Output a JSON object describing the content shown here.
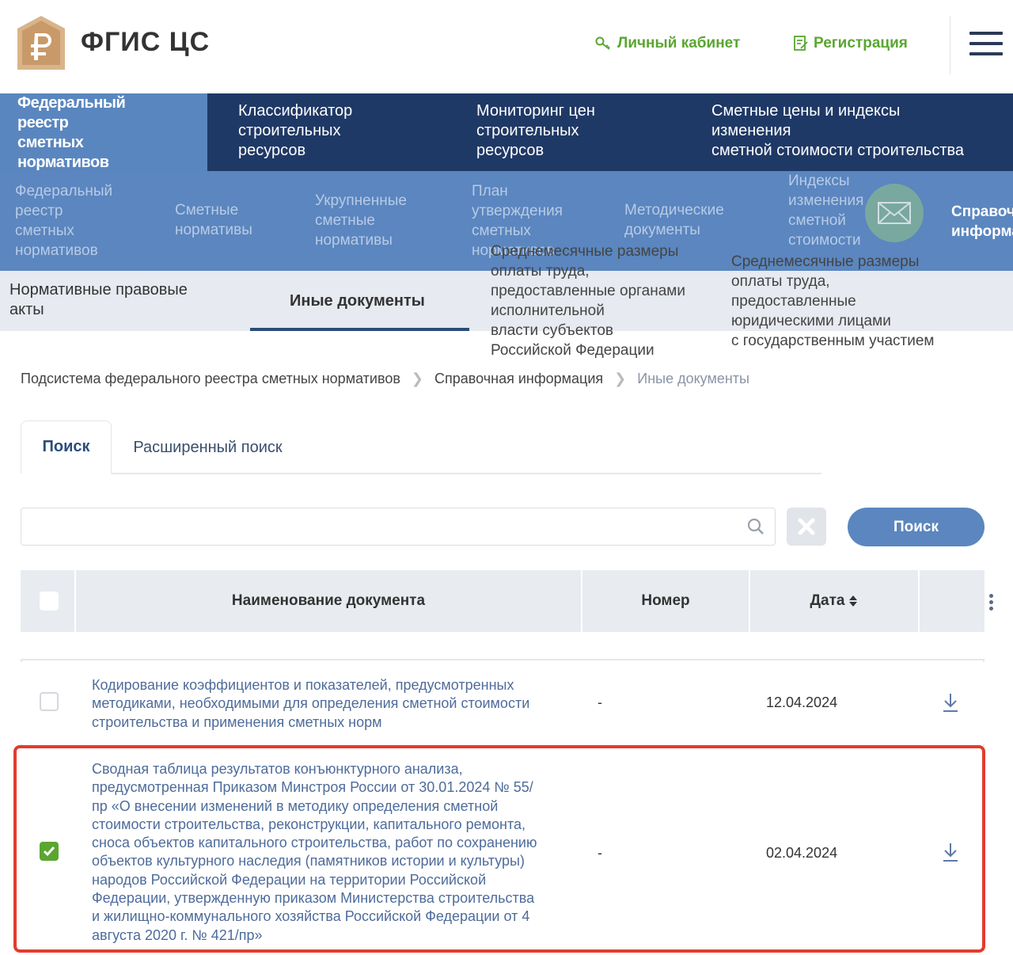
{
  "header": {
    "logo_title": "ФГИС ЦС",
    "cabinet_label": "Личный кабинет",
    "register_label": "Регистрация"
  },
  "topnav": {
    "items": [
      {
        "label_lines": [
          "Федеральный",
          "реестр",
          "сметных",
          "нормативов"
        ]
      },
      {
        "label_lines": [
          "Классификатор",
          "строительных",
          "ресурсов"
        ]
      },
      {
        "label_lines": [
          "Мониторинг цен",
          "строительных",
          "ресурсов"
        ]
      },
      {
        "label_lines": [
          "Сметные цены и индексы",
          "изменения",
          "сметной стоимости строительства"
        ]
      }
    ]
  },
  "subnav": {
    "items": [
      {
        "lines": [
          "Федеральный",
          "реестр",
          "сметных",
          "нормативов"
        ]
      },
      {
        "lines": [
          "Сметные",
          "нормативы"
        ]
      },
      {
        "lines": [
          "Укрупненные",
          "сметные",
          "нормативы"
        ]
      },
      {
        "lines": [
          "План",
          "утверждения",
          "сметных",
          "нормативов"
        ]
      },
      {
        "lines": [
          "Методические",
          "документы"
        ]
      },
      {
        "lines": [
          "Индексы",
          "изменения",
          "сметной",
          "стоимости"
        ]
      },
      {
        "lines": [
          "Справочная",
          "информация"
        ]
      }
    ]
  },
  "tertiary": {
    "items": [
      {
        "lines": [
          "Нормативные правовые",
          "акты"
        ]
      },
      {
        "lines": [
          "Иные документы"
        ]
      }
    ],
    "dropdown_1": [
      "Среднемесячные размеры",
      "оплаты труда,",
      "предоставленные органами",
      "исполнительной",
      "власти субъектов",
      "Российской Федерации"
    ],
    "dropdown_2": [
      "Среднемесячные размеры",
      "оплаты труда,",
      "предоставленные",
      "юридическими лицами",
      "с государственным участием"
    ]
  },
  "breadcrumbs": {
    "items": [
      "Подсистема федерального реестра сметных нормативов",
      "Справочная информация",
      "Иные документы"
    ]
  },
  "search_tabs": {
    "basic": "Поиск",
    "advanced": "Расширенный поиск"
  },
  "search": {
    "value": "",
    "button_label": "Поиск"
  },
  "table": {
    "headers": {
      "name": "Наименование документа",
      "number": "Номер",
      "date": "Дата"
    },
    "rows": [
      {
        "name_lines": [
          "Кодирование коэффициентов и показателей, предусмотренных",
          "методиками, необходимыми для определения сметной стоимости",
          "строительства и применения сметных норм"
        ],
        "number": "-",
        "date": "12.04.2024",
        "checked": false
      },
      {
        "name_lines": [
          "Сводная таблица результатов конъюнктурного анализа,",
          "предусмотренная Приказом Минстроя России от 30.01.2024 № 55/",
          "пр «О внесении изменений в методику определения сметной",
          "стоимости строительства, реконструкции, капитального ремонта,",
          "сноса объектов капитального строительства, работ по сохранению",
          "объектов культурного наследия (памятников истории и культуры)",
          "народов Российской Федерации на территории Российской",
          "Федерации, утвержденную приказом Министерства строительства",
          "и жилищно-коммунального хозяйства Российской Федерации от 4",
          "августа 2020 г. № 421/пр»"
        ],
        "number": "-",
        "date": "02.04.2024",
        "checked": true
      }
    ]
  },
  "colors": {
    "navy": "#1f3966",
    "blue": "#5b86bf",
    "green": "#5aa631",
    "highlight": "#e23c2e"
  }
}
